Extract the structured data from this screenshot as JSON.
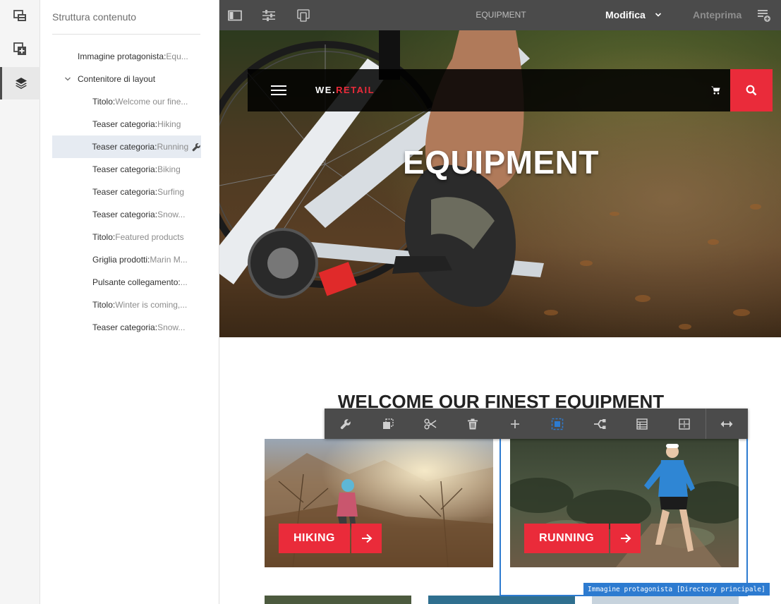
{
  "rail": {
    "items": [
      {
        "icon": "page-layers-icon"
      },
      {
        "icon": "add-component-icon"
      },
      {
        "icon": "layers-icon",
        "active": true
      }
    ]
  },
  "panel": {
    "title": "Struttura contenuto",
    "tree": [
      {
        "label": "Immagine protagonista:",
        "value": " Equ...",
        "level": 0
      },
      {
        "label": "Contenitore di layout",
        "value": "",
        "level": 0,
        "expanded": true
      },
      {
        "label": "Titolo:",
        "value": " Welcome our fine...",
        "level": 1
      },
      {
        "label": "Teaser categoria:",
        "value": " Hiking",
        "level": 1
      },
      {
        "label": "Teaser categoria:",
        "value": "Running",
        "level": 1,
        "selected": true
      },
      {
        "label": "Teaser categoria:",
        "value": " Biking",
        "level": 1
      },
      {
        "label": "Teaser categoria:",
        "value": " Surfing",
        "level": 1
      },
      {
        "label": "Teaser categoria:",
        "value": " Snow...",
        "level": 1
      },
      {
        "label": "Titolo:",
        "value": " Featured products",
        "level": 1
      },
      {
        "label": "Griglia prodotti:",
        "value": " Marin M...",
        "level": 1
      },
      {
        "label": "Pulsante collegamento:",
        "value": "...",
        "level": 1
      },
      {
        "label": "Titolo:",
        "value": " Winter is coming,...",
        "level": 1
      },
      {
        "label": "Teaser categoria:",
        "value": " Snow...",
        "level": 1
      }
    ]
  },
  "topbar": {
    "page_title": "EQUIPMENT",
    "mode_label": "Modifica",
    "preview_label": "Anteprima"
  },
  "page": {
    "logo_prefix": "WE.",
    "logo_suffix": "RETAIL",
    "hero_title": "EQUIPMENT",
    "section_title": "WELCOME OUR FINEST EQUIPMENT",
    "teasers": [
      {
        "label": "HIKING"
      },
      {
        "label": "RUNNING"
      }
    ]
  },
  "editbar": {
    "tools": [
      "configure-icon",
      "copy-icon",
      "cut-icon",
      "delete-icon",
      "insert-icon",
      "select-parent-icon",
      "group-icon",
      "layout-icon",
      "structure-icon",
      "resize-icon"
    ]
  },
  "selection_label": "Immagine protagonista [Directory principale]",
  "colors": {
    "brand_red": "#ea2b3a",
    "selection_blue": "#2d7bd0",
    "topbar_gray": "#4b4b4b"
  }
}
